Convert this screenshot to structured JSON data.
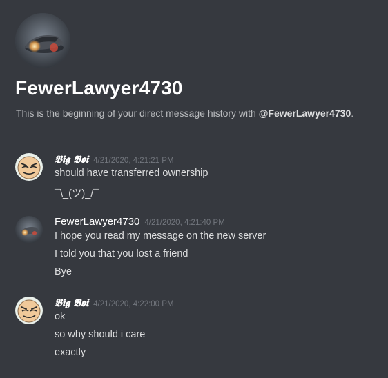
{
  "header": {
    "username": "FewerLawyer4730",
    "intro_prefix": "This is the beginning of your direct message history with ",
    "intro_mention": "@FewerLawyer4730",
    "intro_suffix": "."
  },
  "messages": [
    {
      "author": "𝕭𝖎𝖌 𝕭𝖔𝖎",
      "timestamp": "4/21/2020, 4:21:21 PM",
      "lines": [
        "should have transferred ownership",
        "¯\\_(ツ)_/¯"
      ]
    },
    {
      "author": "FewerLawyer4730",
      "timestamp": "4/21/2020, 4:21:40 PM",
      "lines": [
        "I hope you read my message on the new server",
        "I told you that you lost a friend",
        "Bye"
      ]
    },
    {
      "author": "𝕭𝖎𝖌 𝕭𝖔𝖎",
      "timestamp": "4/21/2020, 4:22:00 PM",
      "lines": [
        "ok",
        "so why should i care",
        "exactly"
      ]
    }
  ],
  "colors": {
    "background": "#36393f",
    "username": "#ffffff",
    "timestamp": "#72767d",
    "text": "#dcddde"
  },
  "icons": {
    "user_avatar": "car-avatar-icon",
    "bigboi_avatar": "cartoon-face-avatar-icon"
  }
}
